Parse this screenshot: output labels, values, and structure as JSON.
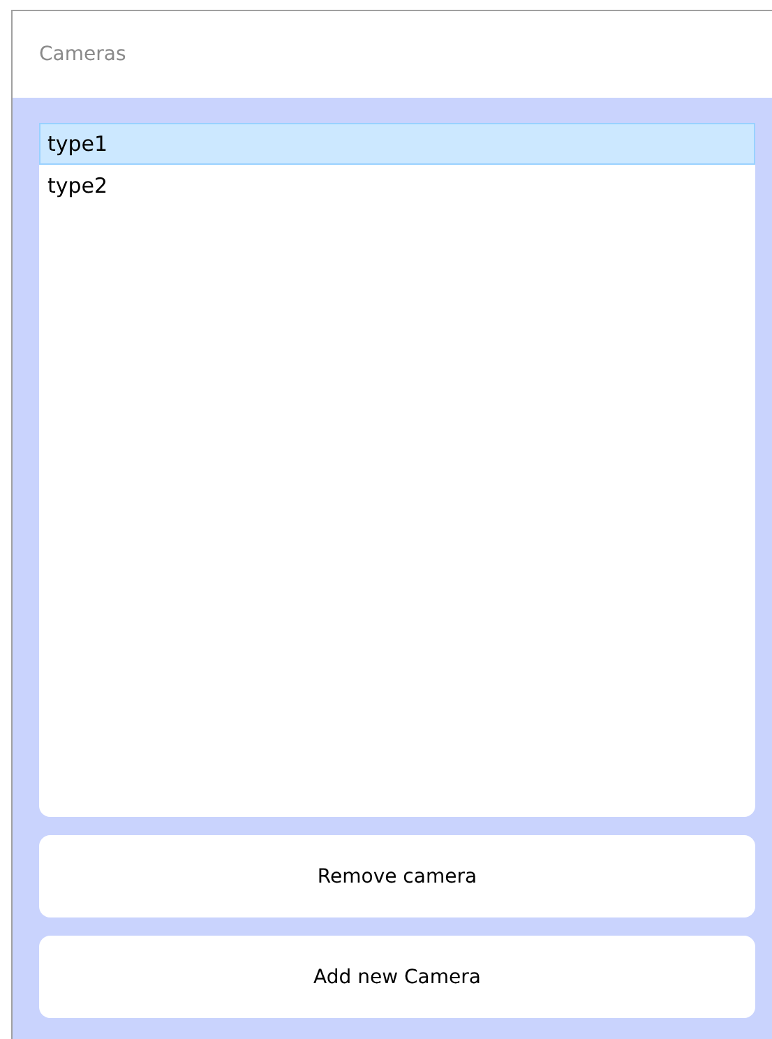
{
  "panel": {
    "title": "Cameras"
  },
  "cameras": [
    {
      "label": "type1",
      "selected": true
    },
    {
      "label": "type2",
      "selected": false
    }
  ],
  "buttons": [
    "Remove camera",
    "Add new Camera"
  ]
}
